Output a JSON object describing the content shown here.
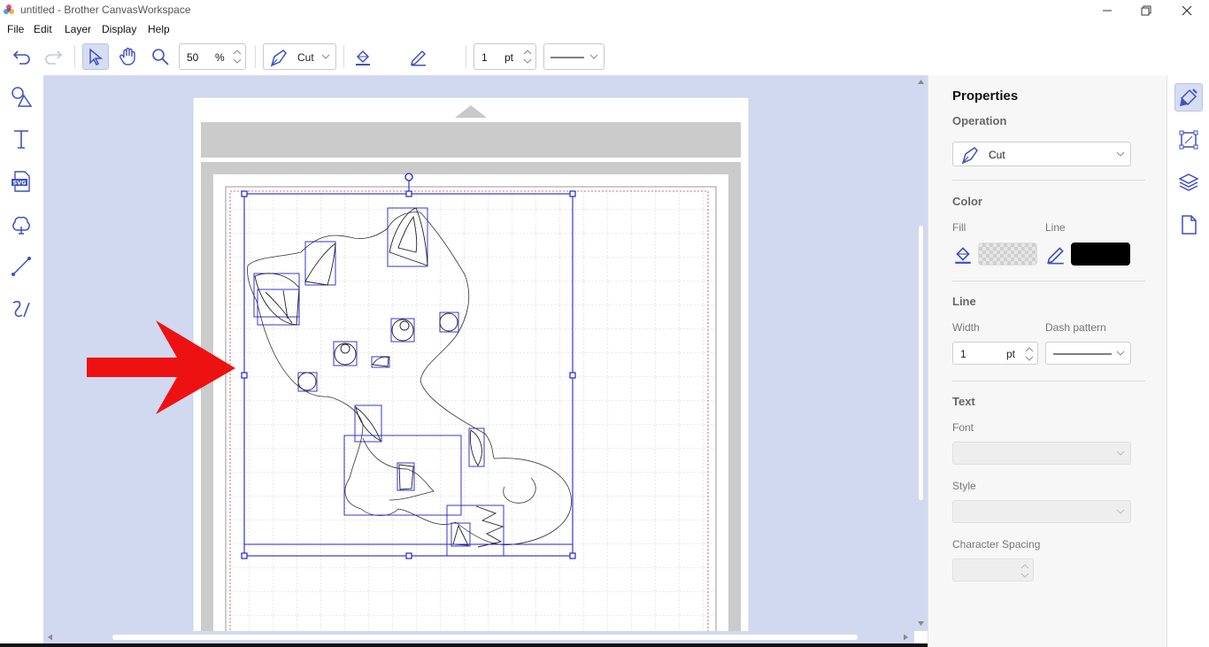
{
  "window": {
    "title": "untitled - Brother CanvasWorkspace"
  },
  "menu": [
    "File",
    "Edit",
    "Layer",
    "Display",
    "Help"
  ],
  "toolbar": {
    "zoom_value": "50",
    "zoom_unit": "%",
    "operation": "Cut",
    "line_width_value": "1",
    "line_width_unit": "pt",
    "line_color": "#000000"
  },
  "left_tools": [
    "shapes-icon",
    "text-icon",
    "svg-import-icon",
    "pattern-icon",
    "line-icon",
    "freehand-icon"
  ],
  "properties": {
    "title": "Properties",
    "operation_section": "Operation",
    "operation_value": "Cut",
    "color_section": "Color",
    "fill_label": "Fill",
    "line_label": "Line",
    "line_color": "#000000",
    "line_section": "Line",
    "width_label": "Width",
    "width_value": "1",
    "width_unit": "pt",
    "dash_label": "Dash pattern",
    "text_section": "Text",
    "font_label": "Font",
    "style_label": "Style",
    "char_spacing_label": "Character Spacing"
  },
  "right_tools": [
    "properties-brush-icon",
    "transform-icon",
    "layers-icon",
    "page-icon"
  ],
  "colors": {
    "accent": "#3f51c0",
    "canvas_bg": "#d1d9f0",
    "selection": "#2222cc",
    "annotation_arrow": "#ee1111"
  }
}
